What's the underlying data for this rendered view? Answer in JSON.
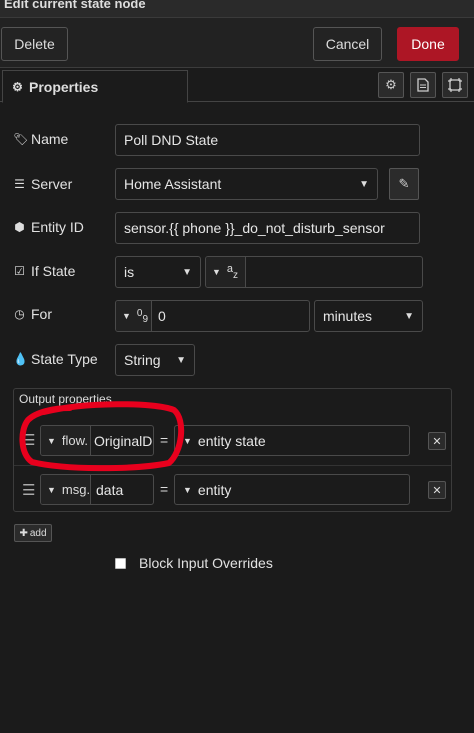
{
  "window": {
    "title": "Edit current state node"
  },
  "toolbar": {
    "delete_label": "Delete",
    "cancel_label": "Cancel",
    "done_label": "Done"
  },
  "tabs": {
    "properties_label": "Properties"
  },
  "form": {
    "name": {
      "label": "Name",
      "value": "Poll DND State"
    },
    "server": {
      "label": "Server",
      "value": "Home Assistant"
    },
    "entity_id": {
      "label": "Entity ID",
      "value": "sensor.{{ phone }}_do_not_disturb_sensor"
    },
    "if_state": {
      "label": "If State",
      "operator": "is",
      "type_glyph": "a",
      "type_glyph_sub": "z",
      "value": ""
    },
    "for": {
      "label": "For",
      "type_glyph": "0",
      "type_glyph_sub": "9",
      "value": "0",
      "unit": "minutes"
    },
    "state_type": {
      "label": "State Type",
      "value": "String"
    }
  },
  "output": {
    "label": "Output properties",
    "rows": [
      {
        "type": "flow.",
        "property": "OriginalDN",
        "equals": "=",
        "value_type": "entity state"
      },
      {
        "type": "msg.",
        "property": "data",
        "equals": "=",
        "value_type": "entity"
      }
    ],
    "add_label": "add"
  },
  "block_input": {
    "label": "Block Input Overrides",
    "checked": false
  },
  "colors": {
    "accent": "#ad1625",
    "annotation": "#e8001d",
    "background": "#1b1b1b"
  },
  "icons": [
    "tag-icon",
    "server-icon",
    "cube-icon",
    "check-square-icon",
    "clock-icon",
    "drop-icon",
    "gear-icon",
    "file-icon",
    "frame-icon",
    "pencil-icon",
    "drag-handle-icon",
    "close-icon",
    "plus-icon"
  ]
}
